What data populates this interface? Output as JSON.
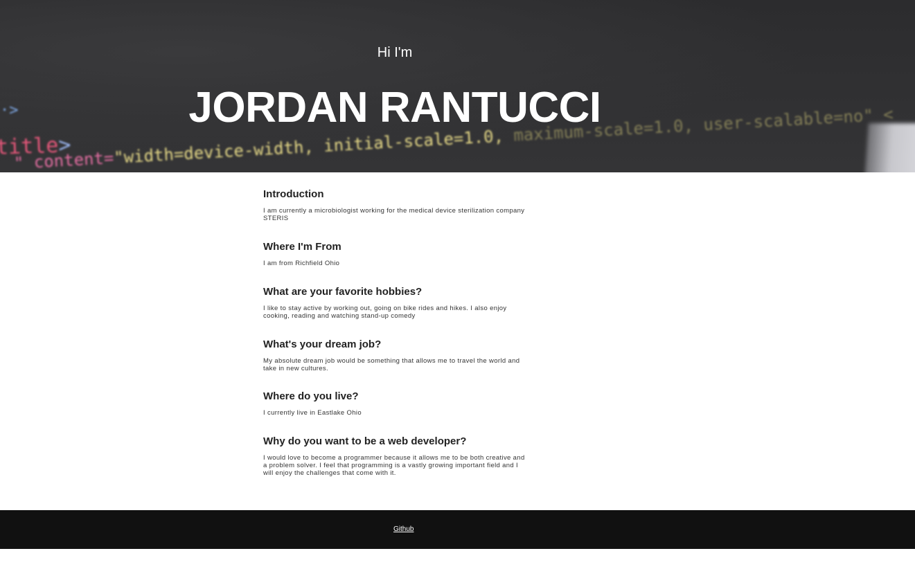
{
  "hero": {
    "greeting": "Hi I'm",
    "name": "JORDAN RANTUCCI",
    "background_code": {
      "arrow": "·>",
      "title_tag": "title",
      "title_tag_end": ">",
      "meta_attr": "\" content=",
      "meta_value": "\"width=device-width, initial-scale=1.0,",
      "meta_faint": " maximum-scale=1.0, user-scalable=no\" <"
    }
  },
  "sections": [
    {
      "heading": "Introduction",
      "text": "I am currently a microbiologist working for the medical device sterilization company STERIS"
    },
    {
      "heading": "Where I'm From",
      "text": "I am from Richfield Ohio"
    },
    {
      "heading": "What are your favorite hobbies?",
      "text": "I like to stay active by working out, going on bike rides and hikes. I also enjoy cooking, reading and watching stand-up comedy"
    },
    {
      "heading": "What's your dream job?",
      "text": "My absolute dream job would be something that allows me to travel the world and take in new cultures."
    },
    {
      "heading": "Where do you live?",
      "text": "I currently live in Eastlake Ohio"
    },
    {
      "heading": "Why do you want to be a web developer?",
      "text": "I would love to become a programmer because it allows me to be both creative and a problem solver. I feel that programming is a vastly growing important field and I will enjoy the challenges that come with it."
    }
  ],
  "footer": {
    "github_label": "Github"
  },
  "colors": {
    "hero_bg": "#2f2f31",
    "footer_bg": "#111111",
    "heading": "#222222",
    "body_text": "#333333"
  }
}
